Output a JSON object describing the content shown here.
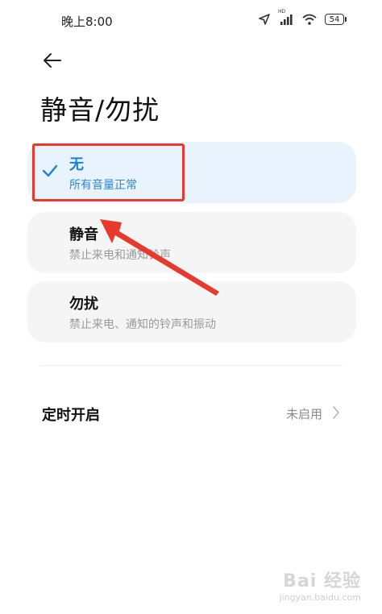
{
  "status_bar": {
    "time": "晚上8:00",
    "battery": "54",
    "network_label": "HD"
  },
  "header": {
    "title": "静音/勿扰"
  },
  "options": [
    {
      "title": "无",
      "desc": "所有音量正常",
      "selected": true
    },
    {
      "title": "静音",
      "desc": "禁止来电和通知铃声",
      "selected": false
    },
    {
      "title": "勿扰",
      "desc": "禁止来电、通知的铃声和振动",
      "selected": false
    }
  ],
  "schedule": {
    "label": "定时开启",
    "value": "未启用"
  },
  "watermark": {
    "brand": "Bai 经验",
    "url": "jingyan.baidu.com"
  },
  "colors": {
    "accent": "#1f7fd6",
    "selected_bg": "#e8f3fd",
    "card_bg": "#f5f5f5",
    "annotation_red": "#e8392f"
  }
}
